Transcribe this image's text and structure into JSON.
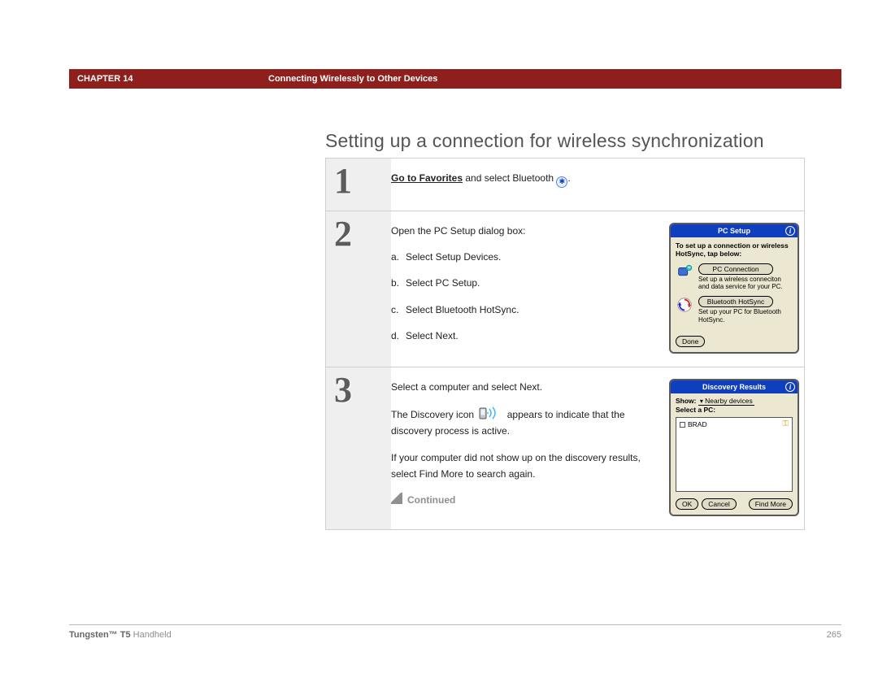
{
  "header": {
    "chapter": "CHAPTER 14",
    "title": "Connecting Wirelessly to Other Devices"
  },
  "section_title": "Setting up a connection for wireless synchronization",
  "steps": [
    {
      "num": "1",
      "link_text": "Go to Favorites",
      "tail_text": " and select Bluetooth ",
      "period": "."
    },
    {
      "num": "2",
      "intro": "Open the PC Setup dialog box:",
      "items": [
        {
          "letter": "a.",
          "text": "Select Setup Devices."
        },
        {
          "letter": "b.",
          "text": "Select PC Setup."
        },
        {
          "letter": "c.",
          "text": "Select Bluetooth HotSync."
        },
        {
          "letter": "d.",
          "text": "Select Next."
        }
      ],
      "screenshot": {
        "title": "PC Setup",
        "tip": "To set up a connection or wireless HotSync, tap below:",
        "r1_pill": "PC Connection",
        "r1_desc": "Set up a wireless conneciton and data service for your PC.",
        "r2_pill": "Bluetooth HotSync",
        "r2_desc": "Set up your PC for Bluetooth HotSync.",
        "done": "Done"
      }
    },
    {
      "num": "3",
      "p1": "Select a computer and select Next.",
      "p2a": "The Discovery icon ",
      "p2b": " appears to indicate that the discovery process is active.",
      "p3": "If your computer did not show up on the discovery results, select Find More to search again.",
      "continued": "Continued",
      "screenshot": {
        "title": "Discovery Results",
        "show_label": "Show:",
        "show_value": "Nearby devices",
        "select_label": "Select a PC:",
        "item": "BRAD",
        "ok": "OK",
        "cancel": "Cancel",
        "find": "Find More"
      }
    }
  ],
  "footer": {
    "product_bold": "Tungsten™ T5",
    "product_tail": " Handheld",
    "page": "265"
  }
}
